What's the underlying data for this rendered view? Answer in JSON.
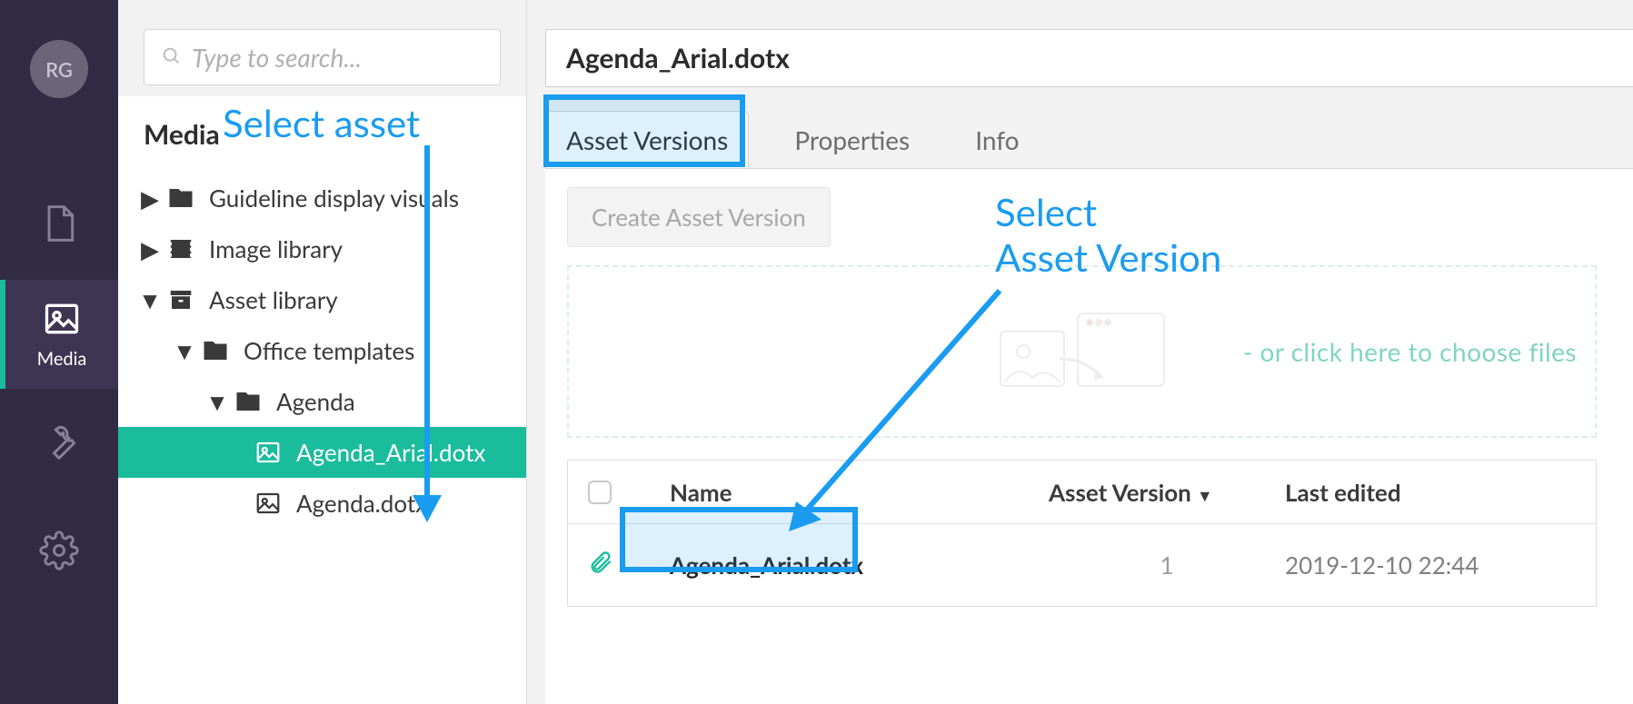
{
  "rail": {
    "avatar_initials": "RG",
    "items": [
      {
        "name": "documents",
        "label": ""
      },
      {
        "name": "media",
        "label": "Media"
      },
      {
        "name": "tools",
        "label": ""
      },
      {
        "name": "settings",
        "label": ""
      }
    ],
    "active_index": 1
  },
  "search": {
    "placeholder": "Type to search..."
  },
  "tree": {
    "heading": "Media",
    "nodes": [
      {
        "label": "Guideline display visuals",
        "icon": "folder",
        "indent": 0,
        "expanded": false
      },
      {
        "label": "Image library",
        "icon": "film",
        "indent": 0,
        "expanded": false
      },
      {
        "label": "Asset library",
        "icon": "archive",
        "indent": 0,
        "expanded": true
      },
      {
        "label": "Office templates",
        "icon": "folder",
        "indent": 1,
        "expanded": true
      },
      {
        "label": "Agenda",
        "icon": "folder",
        "indent": 2,
        "expanded": true
      },
      {
        "label": "Agenda_Arial.dotx",
        "icon": "image",
        "indent": 3,
        "selected": true
      },
      {
        "label": "Agenda.dotx",
        "icon": "image",
        "indent": 3
      }
    ]
  },
  "main": {
    "title": "Agenda_Arial.dotx",
    "tabs": [
      {
        "label": "Asset Versions",
        "active": true
      },
      {
        "label": "Properties"
      },
      {
        "label": "Info"
      }
    ],
    "create_button": "Create Asset Version",
    "dropzone_text": "- or click here to choose files",
    "table": {
      "columns": {
        "name": "Name",
        "version": "Asset Version",
        "edited": "Last edited"
      },
      "rows": [
        {
          "name": "Agenda_Arial.dotx",
          "version": "1",
          "edited": "2019-12-10 22:44"
        }
      ]
    }
  },
  "annotations": {
    "select_asset": "Select asset",
    "select_version_l1": "Select",
    "select_version_l2": "Asset Version"
  }
}
